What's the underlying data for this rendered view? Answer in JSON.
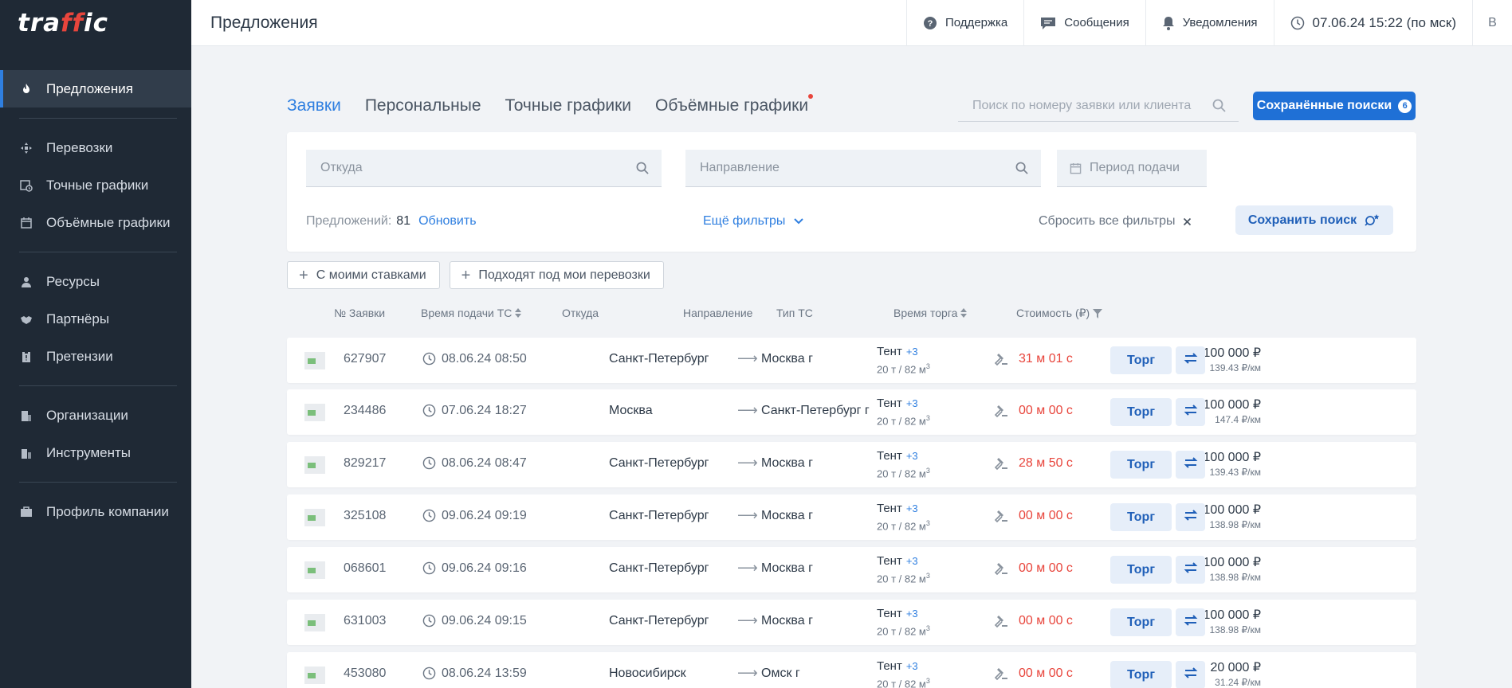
{
  "logo": {
    "text_a": "tra",
    "text_b": "ff",
    "text_c": "ic"
  },
  "sidebar": {
    "items": [
      {
        "label": "Предложения",
        "icon": "fire-icon",
        "active": true
      },
      {
        "label": "Перевозки",
        "icon": "arrows-icon"
      },
      {
        "label": "Точные графики",
        "icon": "calendar-clock-icon"
      },
      {
        "label": "Объёмные графики",
        "icon": "calendar-icon"
      },
      {
        "label": "Ресурсы",
        "icon": "person-icon"
      },
      {
        "label": "Партнёры",
        "icon": "handshake-icon"
      },
      {
        "label": "Претензии",
        "icon": "clipboard-icon"
      },
      {
        "label": "Организации",
        "icon": "building-icon"
      },
      {
        "label": "Инструменты",
        "icon": "tools-icon"
      },
      {
        "label": "Профиль компании",
        "icon": "briefcase-icon"
      }
    ]
  },
  "header": {
    "title": "Предложения",
    "support": "Поддержка",
    "messages": "Сообщения",
    "notifications": "Уведомления",
    "datetime": "07.06.24 15:22 (по мск)",
    "avatar": "В"
  },
  "tabs": [
    {
      "label": "Заявки",
      "active": true
    },
    {
      "label": "Персональные"
    },
    {
      "label": "Точные графики"
    },
    {
      "label": "Объёмные графики",
      "dot": true
    }
  ],
  "search": {
    "placeholder": "Поиск по номеру заявки или клиента"
  },
  "saved_searches": {
    "label": "Сохранённые поиски",
    "count": "6"
  },
  "filters": {
    "from_placeholder": "Откуда",
    "to_placeholder": "Направление",
    "period_placeholder": "Период подачи",
    "count_label": "Предложений:",
    "count": "81",
    "refresh": "Обновить",
    "more": "Ещё фильтры",
    "reset": "Сбросить все фильтры",
    "save": "Сохранить поиск"
  },
  "chips": [
    "С моими ставками",
    "Подходят под мои перевозки"
  ],
  "columns": {
    "number": "№ Заявки",
    "time": "Время подачи ТС",
    "from": "Откуда",
    "to": "Направление",
    "type": "Тип ТС",
    "auction": "Время торга",
    "cost": "Стоимость (₽)"
  },
  "rows": [
    {
      "number": "627907",
      "time": "08.06.24 08:50",
      "from": "Санкт-Петербург",
      "to": "Москва г",
      "type": "Тент",
      "more": "+3",
      "cap": "20 т / 82 м",
      "timer": "31 м 01 с",
      "price": "100 000 ₽",
      "perkm": "139.43 ₽/км"
    },
    {
      "number": "234486",
      "time": "07.06.24 18:27",
      "from": "Москва",
      "to": "Санкт-Петербург г",
      "type": "Тент",
      "more": "+3",
      "cap": "20 т / 82 м",
      "timer": "00 м 00 с",
      "price": "100 000 ₽",
      "perkm": "147.4 ₽/км"
    },
    {
      "number": "829217",
      "time": "08.06.24 08:47",
      "from": "Санкт-Петербург",
      "to": "Москва г",
      "type": "Тент",
      "more": "+3",
      "cap": "20 т / 82 м",
      "timer": "28 м 50 с",
      "price": "100 000 ₽",
      "perkm": "139.43 ₽/км"
    },
    {
      "number": "325108",
      "time": "09.06.24 09:19",
      "from": "Санкт-Петербург",
      "to": "Москва г",
      "type": "Тент",
      "more": "+3",
      "cap": "20 т / 82 м",
      "timer": "00 м 00 с",
      "price": "100 000 ₽",
      "perkm": "138.98 ₽/км"
    },
    {
      "number": "068601",
      "time": "09.06.24 09:16",
      "from": "Санкт-Петербург",
      "to": "Москва г",
      "type": "Тент",
      "more": "+3",
      "cap": "20 т / 82 м",
      "timer": "00 м 00 с",
      "price": "100 000 ₽",
      "perkm": "138.98 ₽/км"
    },
    {
      "number": "631003",
      "time": "09.06.24 09:15",
      "from": "Санкт-Петербург",
      "to": "Москва г",
      "type": "Тент",
      "more": "+3",
      "cap": "20 т / 82 м",
      "timer": "00 м 00 с",
      "price": "100 000 ₽",
      "perkm": "138.98 ₽/км"
    },
    {
      "number": "453080",
      "time": "08.06.24 13:59",
      "from": "Новосибирск",
      "to": "Омск г",
      "type": "Тент",
      "more": "+3",
      "cap": "20 т / 82 м",
      "timer": "00 м 00 с",
      "price": "20 000 ₽",
      "perkm": "31.24 ₽/км"
    }
  ],
  "row_actions": {
    "bid": "Торг"
  },
  "colors": {
    "accent": "#2f7fe0",
    "primary_button": "#1f70d6",
    "sidebar": "#1f2935",
    "timer": "#e8453c"
  }
}
